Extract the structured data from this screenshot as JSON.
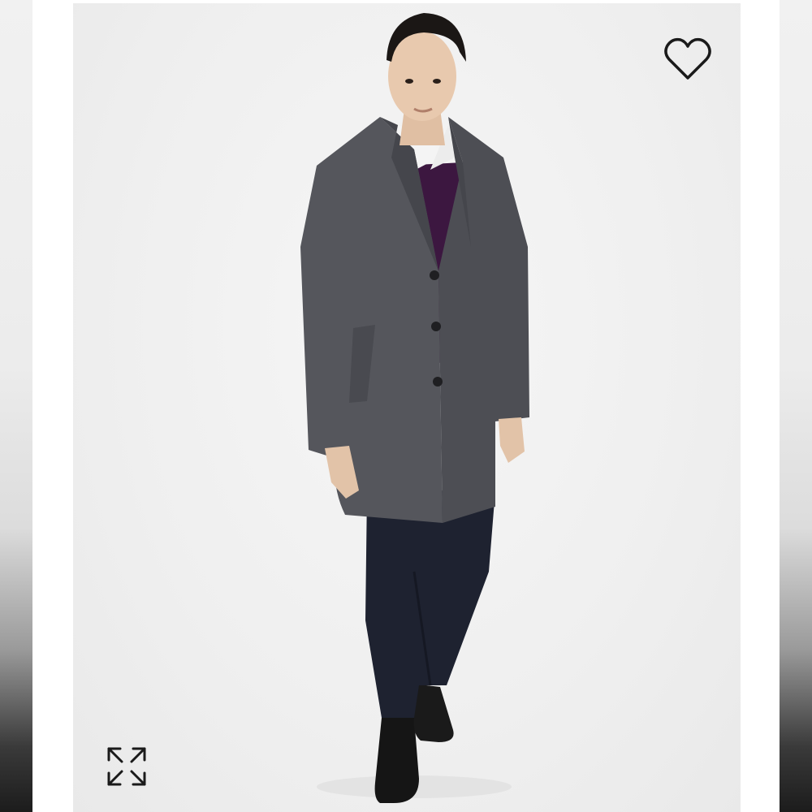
{
  "product": {
    "image_alt": "",
    "background_color": "#efefef"
  },
  "favorite": {
    "icon": "heart-outline-icon",
    "selected": false
  },
  "expand": {
    "icon": "expand-arrows-icon"
  },
  "colors": {
    "coat": "#55565c",
    "sweater": "#3c1740",
    "jeans": "#1e2230",
    "shirt": "#f4f4f4",
    "shoes": "#151515",
    "icon_stroke": "#1a1a1a"
  }
}
